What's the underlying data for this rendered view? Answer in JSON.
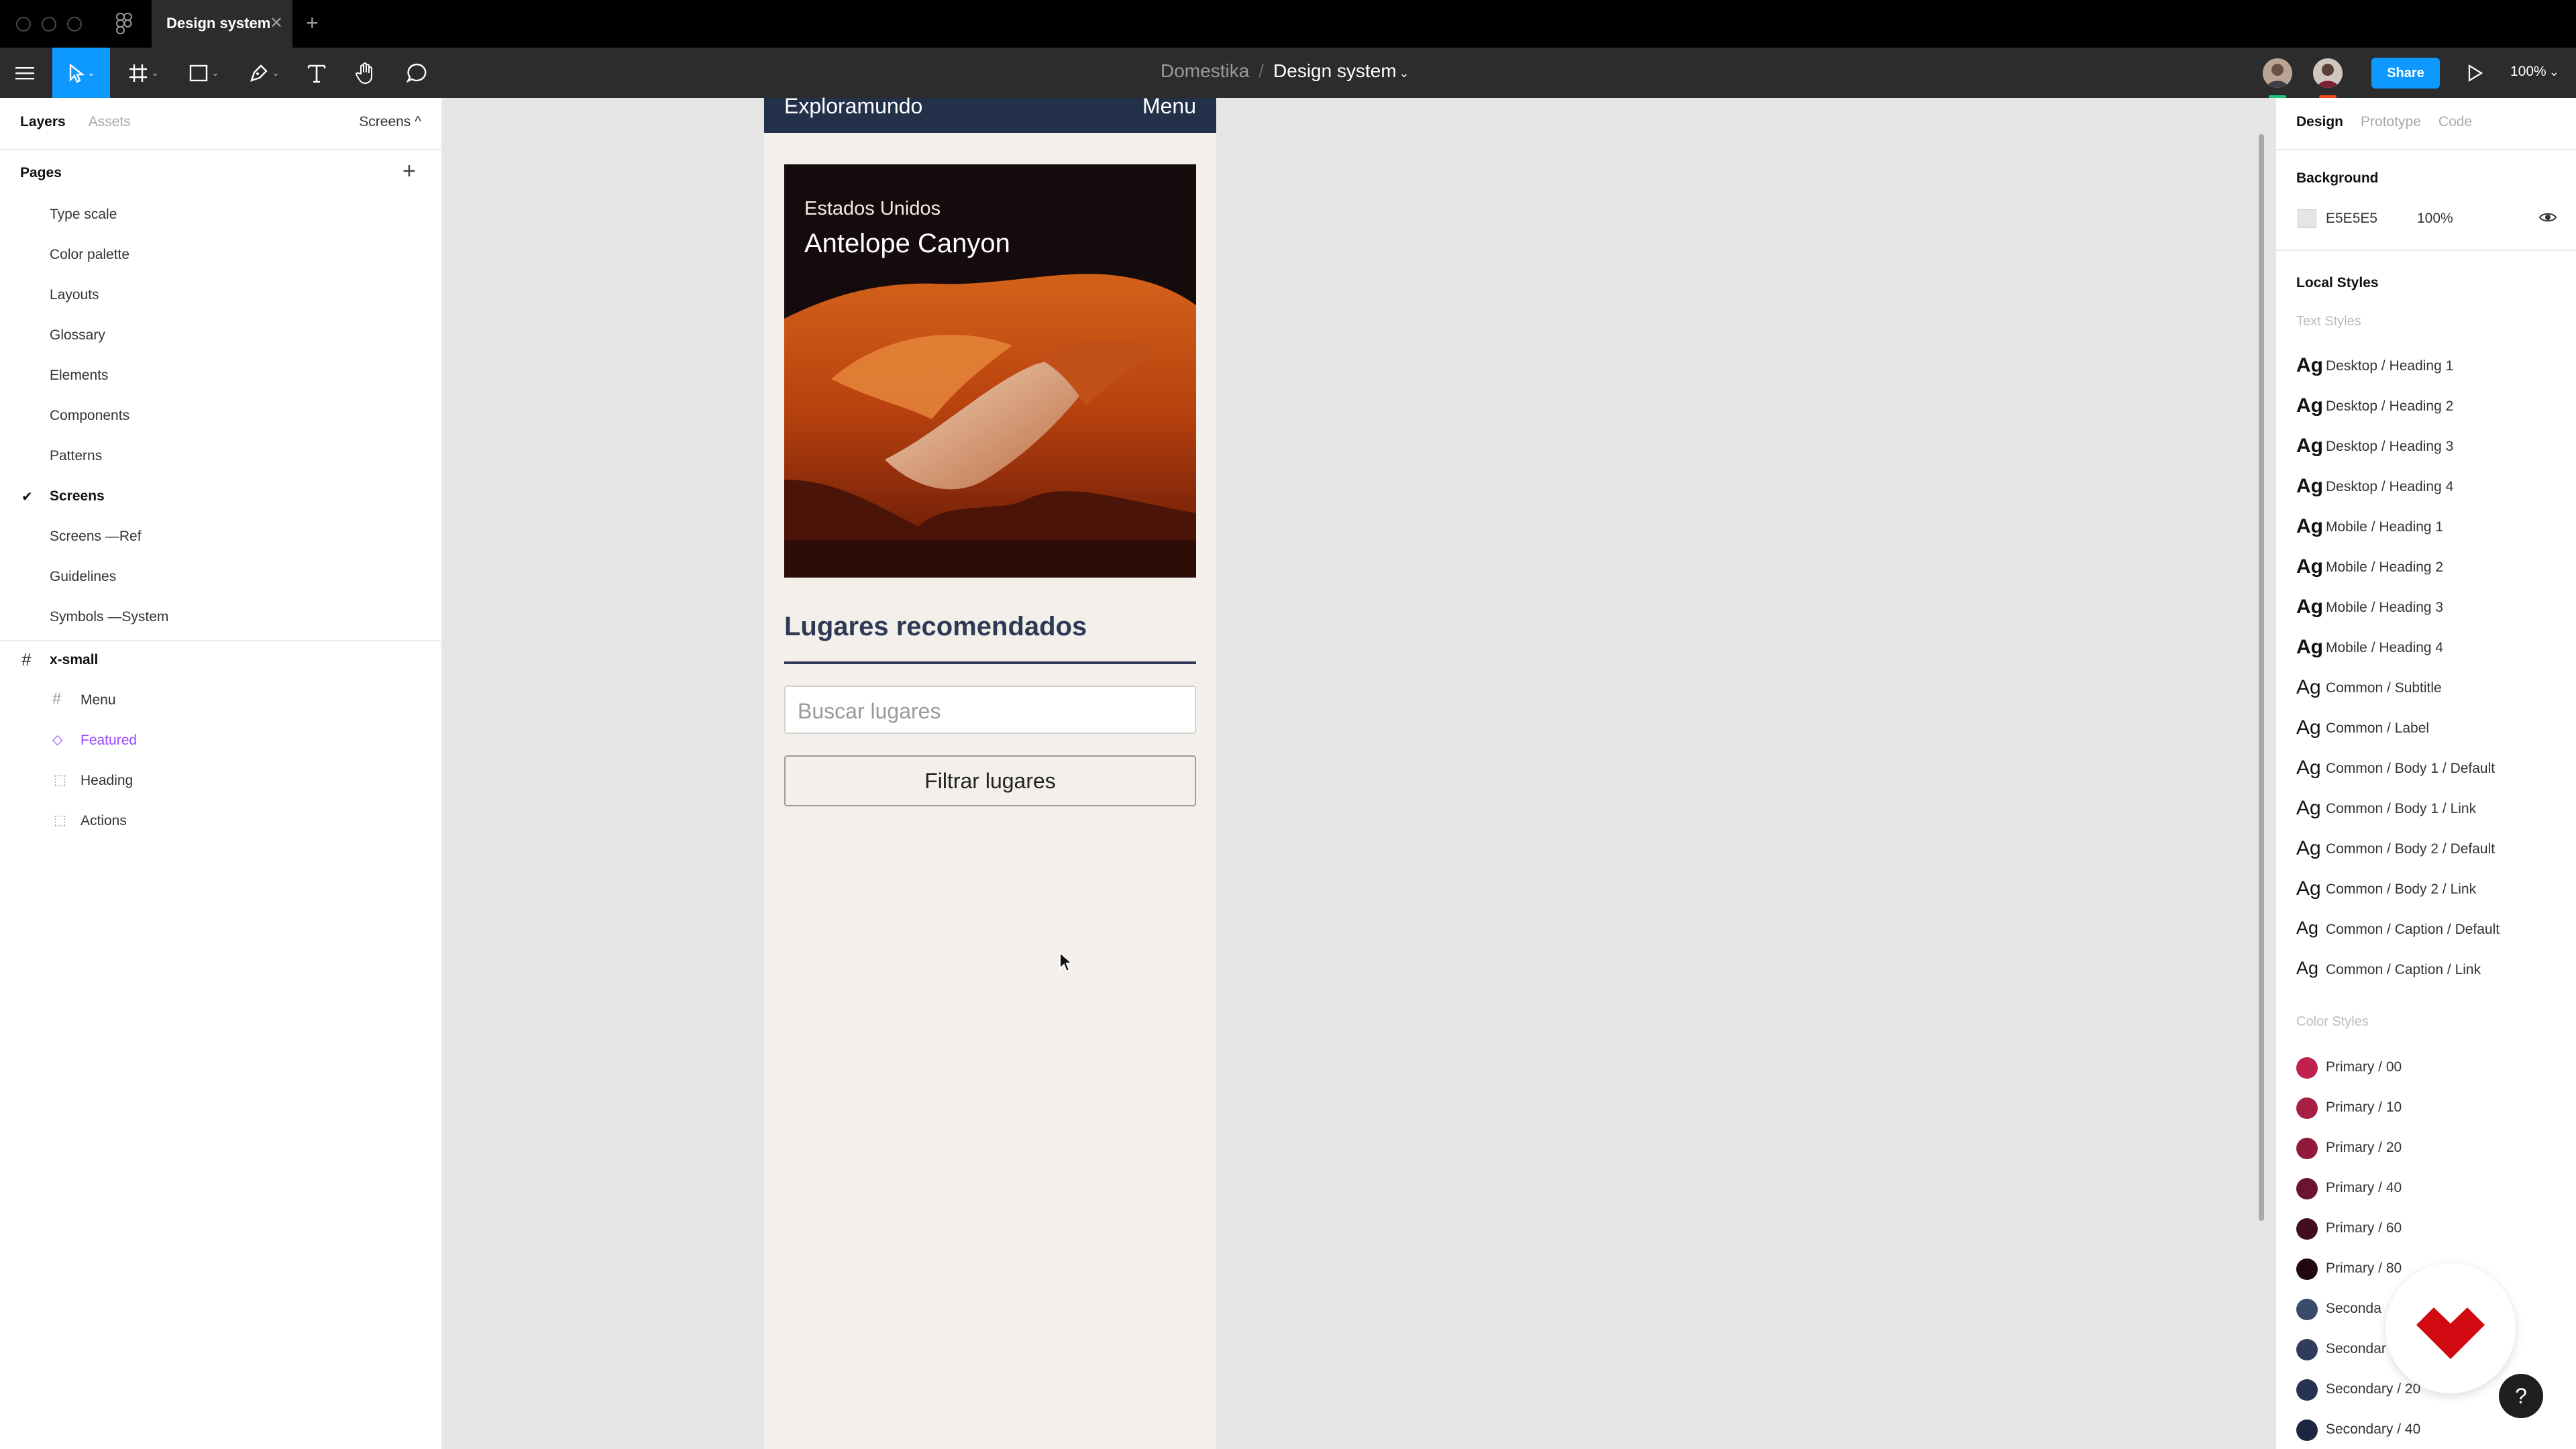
{
  "tab": {
    "title": "Design system"
  },
  "breadcrumb": {
    "project": "Domestika",
    "separator": "/",
    "file": "Design system"
  },
  "toolbar": {
    "share_label": "Share",
    "zoom": "100%"
  },
  "left_panel": {
    "tabs": [
      "Layers",
      "Assets"
    ],
    "page_selector": "Screens ^",
    "pages_title": "Pages",
    "pages": [
      "Type scale",
      "Color palette",
      "Layouts",
      "Glossary",
      "Elements",
      "Components",
      "Patterns",
      "Screens",
      "Screens —Ref",
      "Guidelines",
      "Symbols —System"
    ],
    "active_page": "Screens",
    "layers": {
      "frame": "x-small",
      "children": [
        "Menu",
        "Featured",
        "Heading",
        "Actions"
      ]
    }
  },
  "frame": {
    "brand": "Exploramundo",
    "menu": "Menu",
    "card_subtitle": "Estados Unidos",
    "card_title": "Antelope Canyon",
    "heading": "Lugares recomendados",
    "search_placeholder": "Buscar lugares",
    "filter_button": "Filtrar lugares"
  },
  "right_panel": {
    "tabs": [
      "Design",
      "Prototype",
      "Code"
    ],
    "background_title": "Background",
    "background_hex": "E5E5E5",
    "background_opacity": "100%",
    "local_styles_title": "Local Styles",
    "text_styles_title": "Text Styles",
    "text_styles": [
      "Desktop / Heading 1",
      "Desktop / Heading 2",
      "Desktop / Heading 3",
      "Desktop / Heading 4",
      "Mobile / Heading 1",
      "Mobile / Heading 2",
      "Mobile / Heading 3",
      "Mobile / Heading 4",
      "Common / Subtitle",
      "Common / Label",
      "Common / Body 1 / Default",
      "Common / Body 1 / Link",
      "Common / Body 2 / Default",
      "Common / Body 2 / Link",
      "Common / Caption / Default",
      "Common / Caption / Link"
    ],
    "color_styles_title": "Color Styles",
    "color_styles": [
      {
        "name": "Primary / 00",
        "color": "#c0224e"
      },
      {
        "name": "Primary / 10",
        "color": "#a81f44"
      },
      {
        "name": "Primary / 20",
        "color": "#8f1a3a"
      },
      {
        "name": "Primary / 40",
        "color": "#6a1430"
      },
      {
        "name": "Primary / 60",
        "color": "#420d1f"
      },
      {
        "name": "Primary / 80",
        "color": "#220810"
      },
      {
        "name": "Seconda",
        "color": "#3a4a6a"
      },
      {
        "name": "Secondar",
        "color": "#2f3d5a"
      },
      {
        "name": "Secondary / 20",
        "color": "#253250"
      },
      {
        "name": "Secondary / 40",
        "color": "#1c2640"
      }
    ]
  },
  "colors": {
    "accent": "#0d99ff",
    "frame_header": "#223049",
    "heading": "#2e3a55",
    "canvas": "#e5e5e5"
  }
}
